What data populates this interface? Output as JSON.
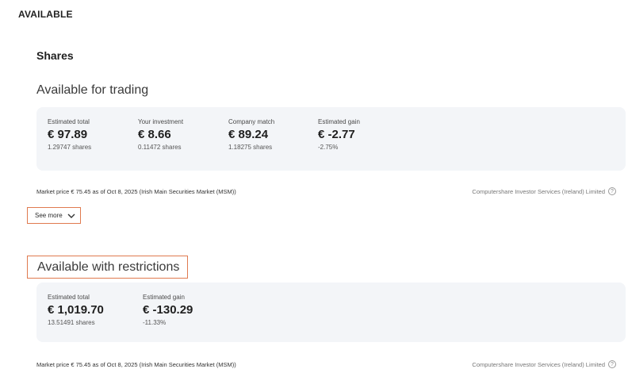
{
  "page": {
    "section_heading": "AVAILABLE",
    "subheading": "Shares"
  },
  "trading": {
    "title": "Available for trading",
    "metrics": [
      {
        "label": "Estimated total",
        "value": "€ 97.89",
        "sub": "1.29747 shares"
      },
      {
        "label": "Your investment",
        "value": "€ 8.66",
        "sub": "0.11472 shares"
      },
      {
        "label": "Company match",
        "value": "€ 89.24",
        "sub": "1.18275 shares"
      },
      {
        "label": "Estimated gain",
        "value": "€ -2.77",
        "sub": "-2.75%"
      }
    ],
    "market_price": "Market price € 75.45 as of Oct 8, 2025 (Irish Main Securities Market (MSM))",
    "provider": "Computershare Investor Services (Ireland) Limited",
    "see_more": "See more"
  },
  "restricted": {
    "title": "Available with restrictions",
    "metrics": [
      {
        "label": "Estimated total",
        "value": "€ 1,019.70",
        "sub": "13.51491 shares"
      },
      {
        "label": "Estimated gain",
        "value": "€ -130.29",
        "sub": "-11.33%"
      }
    ],
    "market_price": "Market price € 75.45 as of Oct 8, 2025 (Irish Main Securities Market (MSM))",
    "provider": "Computershare Investor Services (Ireland) Limited"
  },
  "icons": {
    "help": "question-circle-icon",
    "chevron": "chevron-down-icon"
  }
}
